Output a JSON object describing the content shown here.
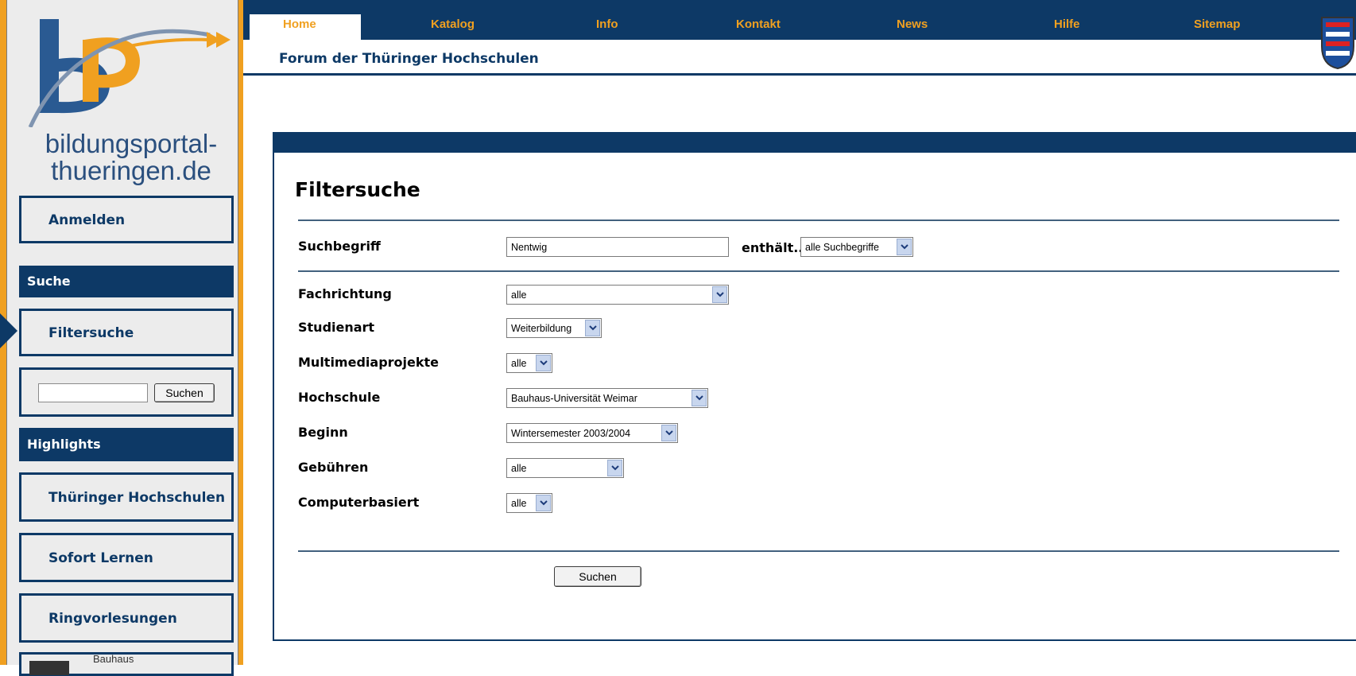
{
  "logo": {
    "line1": "bildungsportal-",
    "line2": "thueringen.de"
  },
  "sidebar": {
    "login": "Anmelden",
    "search_heading": "Suche",
    "filter_search": "Filtersuche",
    "search_input_value": "",
    "search_button": "Suchen",
    "highlights_heading": "Highlights",
    "items": [
      {
        "label": "Thüringer Hochschulen"
      },
      {
        "label": "Sofort Lernen"
      },
      {
        "label": "Ringvorlesungen"
      }
    ],
    "partial_item": "Bauhaus"
  },
  "nav": {
    "items": [
      "Home",
      "Katalog",
      "Info",
      "Kontakt",
      "News",
      "Hilfe",
      "Sitemap"
    ],
    "active": "Home"
  },
  "subheader": {
    "title": "Forum der Thüringer Hochschulen"
  },
  "main": {
    "title": "Filtersuche",
    "fields": {
      "suchbegriff": {
        "label": "Suchbegriff",
        "value": "Nentwig",
        "contains_label": "enthält...",
        "contains_value": "alle Suchbegriffe"
      },
      "fachrichtung": {
        "label": "Fachrichtung",
        "value": "alle"
      },
      "studienart": {
        "label": "Studienart",
        "value": "Weiterbildung"
      },
      "multimedia": {
        "label": "Multimediaprojekte",
        "value": "alle"
      },
      "hochschule": {
        "label": "Hochschule",
        "value": "Bauhaus-Universität Weimar"
      },
      "beginn": {
        "label": "Beginn",
        "value": "Wintersemester 2003/2004"
      },
      "gebuehren": {
        "label": "Gebühren",
        "value": "alle"
      },
      "computerbasiert": {
        "label": "Computerbasiert",
        "value": "alle"
      }
    },
    "submit": "Suchen"
  },
  "colors": {
    "navy": "#0d3966",
    "orange": "#f0a020",
    "sidebar_bg": "#ececec"
  }
}
